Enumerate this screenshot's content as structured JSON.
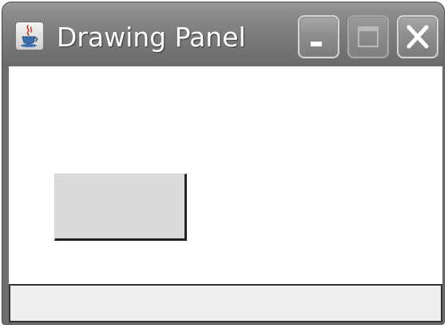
{
  "window": {
    "title": "Drawing Panel",
    "app_icon": "java-cup-icon",
    "controls": {
      "minimize": "minimize-icon",
      "maximize": "maximize-icon",
      "close": "close-icon"
    }
  },
  "canvas": {
    "background": "#ffffff",
    "shapes": [
      {
        "type": "rectangle",
        "fill": "#dadada",
        "outline": "#222222"
      }
    ]
  },
  "status": {
    "text": ""
  }
}
